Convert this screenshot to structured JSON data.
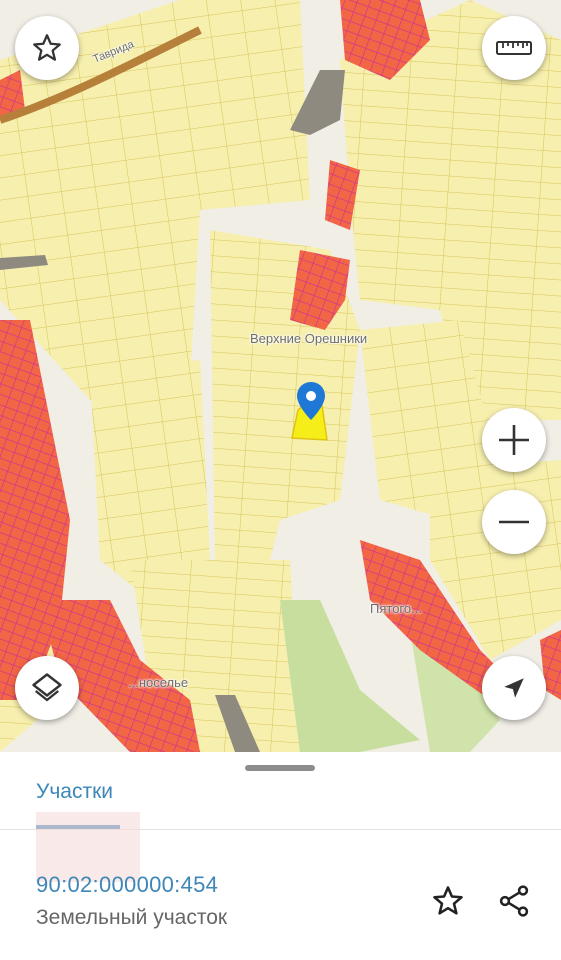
{
  "map": {
    "labels": {
      "village_top": "Верхние Орешники",
      "village_right": "Пятого...",
      "village_left": "...носелье",
      "road_top": "Таврида"
    },
    "controls": {
      "favorites_icon": "star-outline-icon",
      "ruler_icon": "ruler-icon",
      "zoom_in_icon": "plus-icon",
      "zoom_out_icon": "minus-icon",
      "layers_icon": "layers-icon",
      "locate_icon": "navigation-arrow-icon"
    },
    "colors": {
      "parcel_fill": "#f6efad",
      "parcel_stroke": "#d8c45a",
      "built_fill": "#f26545",
      "built_stroke": "#c9309a",
      "selected_fill": "#f5ee19",
      "marker": "#1f78d6"
    }
  },
  "sheet": {
    "tab_label": "Участки",
    "cadastral_number": "90:02:000000:454",
    "object_type": "Земельный участок",
    "favorite_icon": "star-outline-icon",
    "share_icon": "share-icon"
  }
}
